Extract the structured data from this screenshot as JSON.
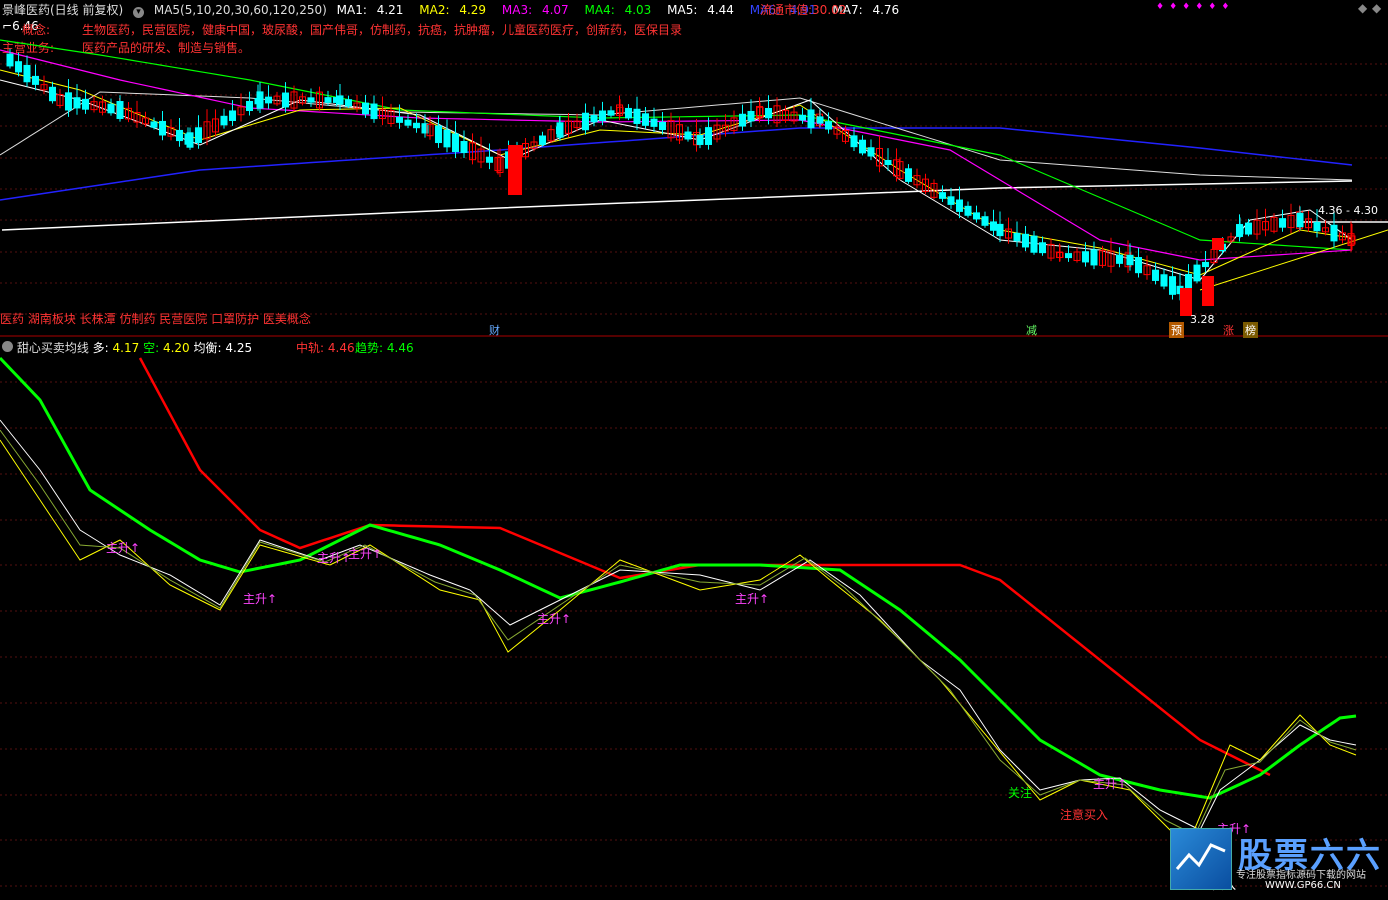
{
  "top": {
    "title": "景峰医药(日线 前复权)",
    "ma_label": "MA5(5,10,20,30,60,120,250)",
    "ma": [
      {
        "name": "MA1:",
        "value": "4.21",
        "color": "#ffffff"
      },
      {
        "name": "MA2:",
        "value": "4.29",
        "color": "#ffff00"
      },
      {
        "name": "MA3:",
        "value": "4.07",
        "color": "#ff00ff"
      },
      {
        "name": "MA4:",
        "value": "4.03",
        "color": "#00ff00"
      },
      {
        "name": "MA5:",
        "value": "4.44",
        "color": "#ffffff"
      },
      {
        "name": "MA6:",
        "value": "4.91",
        "color": "#3333ff"
      },
      {
        "name": "MA7:",
        "value": "4.76",
        "color": "#ffffff"
      }
    ],
    "market_cap_label": "流通市值:",
    "market_cap_value": "30.02"
  },
  "info": {
    "high_price": "6.46",
    "concept_label": "概念:",
    "concept_text": "生物医药，民营医院，健康中国，玻尿酸，国产伟哥，仿制药，抗癌，抗肿瘤，儿童医药医疗，创新药，医保目录",
    "business_label": "主营业务:",
    "business_text": "医药产品的研发、制造与销售。"
  },
  "chart_labels": {
    "price_label_right": "4.36 - 4.30",
    "low_label": "3.28",
    "bottom_tags": "医药 湖南板块 长株潭 仿制药 民营医院 口罩防护 医美概念",
    "marker_cai": "财",
    "marker_jian": "减",
    "marker_yu": "预",
    "marker_zhang": "涨",
    "marker_bang": "榜"
  },
  "indicator": {
    "name": "甜心买卖均线",
    "duo_label": "多:",
    "duo_value": "4.17",
    "kong_label": "空:",
    "kong_value": "4.20",
    "junheng_label": "均衡:",
    "junheng_value": "4.25",
    "zhonggui_label": "中轨:",
    "zhonggui_value": "4.46",
    "qushi_label": "趋势:",
    "qushi_value": "4.46",
    "signals": {
      "zhusheng": "主升↑",
      "guanzhu": "关注",
      "zhuyi": "注意买入"
    }
  },
  "watermark": {
    "name": "股票六六",
    "tagline": "专注股票指标源码下载的网站",
    "url": "WWW.GP66.CN"
  },
  "colors": {
    "up": "#ff0000",
    "down": "#00ffff",
    "ma_white": "#ffffff",
    "ma_yellow": "#ffff00",
    "ma_purple": "#ff00ff",
    "ma_green": "#00ff00",
    "ma_blue": "#2222ff",
    "red_line": "#ff0000",
    "green_line": "#00ff00"
  },
  "icons": [
    "circle-dropdown-icon",
    "diamond-icon",
    "tilde-icon"
  ]
}
